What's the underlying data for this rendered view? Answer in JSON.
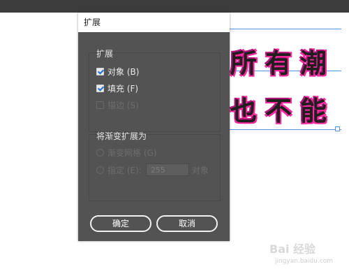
{
  "dialog": {
    "title": "扩展",
    "expand_group": {
      "title": "扩展",
      "object": {
        "label": "对象 (B)",
        "checked": true
      },
      "fill": {
        "label": "填充 (F)",
        "checked": true
      },
      "stroke": {
        "label": "描边 (S)",
        "checked": false,
        "disabled": true
      }
    },
    "gradient_group": {
      "title": "将渐变扩展为",
      "gradient_mesh": {
        "label": "渐变网格 (G)",
        "disabled": true
      },
      "specify": {
        "label": "指定 (E):",
        "value": "255",
        "unit": "对象",
        "disabled": true
      }
    },
    "buttons": {
      "ok": "确定",
      "cancel": "取消"
    }
  },
  "canvas": {
    "line1": "所有潮",
    "line2": "也不能",
    "text_colors": {
      "fill": "#1f1f1f",
      "stroke": "#ff2aa0"
    },
    "selection_color": "#5b8fe0"
  },
  "watermark": {
    "text": "Bai 经验",
    "sub": "jingyan.baidu.com"
  }
}
